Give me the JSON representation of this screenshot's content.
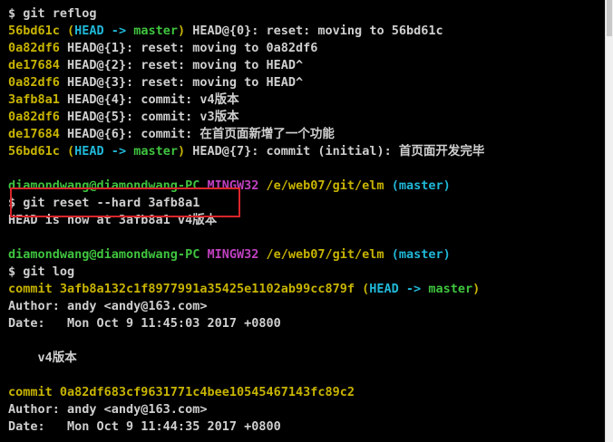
{
  "terminal": {
    "lines": [
      {
        "segments": [
          {
            "text": "$ git reflog",
            "color": "default"
          }
        ]
      },
      {
        "segments": [
          {
            "text": "56bd61c",
            "color": "yellow"
          },
          {
            "text": " (",
            "color": "yellow"
          },
          {
            "text": "HEAD -> ",
            "color": "cyan"
          },
          {
            "text": "master",
            "color": "green"
          },
          {
            "text": ")",
            "color": "yellow"
          },
          {
            "text": " HEAD@{0}: reset: moving to 56bd61c",
            "color": "default"
          }
        ]
      },
      {
        "segments": [
          {
            "text": "0a82df6",
            "color": "yellow"
          },
          {
            "text": " HEAD@{1}: reset: moving to 0a82df6",
            "color": "default"
          }
        ]
      },
      {
        "segments": [
          {
            "text": "de17684",
            "color": "yellow"
          },
          {
            "text": " HEAD@{2}: reset: moving to HEAD^",
            "color": "default"
          }
        ]
      },
      {
        "segments": [
          {
            "text": "0a82df6",
            "color": "yellow"
          },
          {
            "text": " HEAD@{3}: reset: moving to HEAD^",
            "color": "default"
          }
        ]
      },
      {
        "segments": [
          {
            "text": "3afb8a1",
            "color": "yellow"
          },
          {
            "text": " HEAD@{4}: commit: v4版本",
            "color": "default"
          }
        ]
      },
      {
        "segments": [
          {
            "text": "0a82df6",
            "color": "yellow"
          },
          {
            "text": " HEAD@{5}: commit: v3版本",
            "color": "default"
          }
        ]
      },
      {
        "segments": [
          {
            "text": "de17684",
            "color": "yellow"
          },
          {
            "text": " HEAD@{6}: commit: 在首页面新增了一个功能",
            "color": "default"
          }
        ]
      },
      {
        "segments": [
          {
            "text": "56bd61c",
            "color": "yellow"
          },
          {
            "text": " (",
            "color": "yellow"
          },
          {
            "text": "HEAD -> ",
            "color": "cyan"
          },
          {
            "text": "master",
            "color": "green"
          },
          {
            "text": ")",
            "color": "yellow"
          },
          {
            "text": " HEAD@{7}: commit (initial): 首页面开发完毕",
            "color": "default"
          }
        ]
      },
      {
        "segments": [
          {
            "text": "",
            "color": "default"
          }
        ]
      },
      {
        "segments": [
          {
            "text": "diamondwang@diamondwang-PC",
            "color": "green"
          },
          {
            "text": " ",
            "color": "default"
          },
          {
            "text": "MINGW32",
            "color": "magenta"
          },
          {
            "text": " ",
            "color": "default"
          },
          {
            "text": "/e/web07/git/elm",
            "color": "yellow"
          },
          {
            "text": " (master)",
            "color": "cyan"
          }
        ]
      },
      {
        "segments": [
          {
            "text": "$ git reset --hard 3afb8a1",
            "color": "default"
          }
        ]
      },
      {
        "segments": [
          {
            "text": "HEAD is now at 3afb8a1 v4版本",
            "color": "default"
          }
        ]
      },
      {
        "segments": [
          {
            "text": "",
            "color": "default"
          }
        ]
      },
      {
        "segments": [
          {
            "text": "diamondwang@diamondwang-PC",
            "color": "green"
          },
          {
            "text": " ",
            "color": "default"
          },
          {
            "text": "MINGW32",
            "color": "magenta"
          },
          {
            "text": " ",
            "color": "default"
          },
          {
            "text": "/e/web07/git/elm",
            "color": "yellow"
          },
          {
            "text": " (master)",
            "color": "cyan"
          }
        ]
      },
      {
        "segments": [
          {
            "text": "$ git log",
            "color": "default"
          }
        ]
      },
      {
        "segments": [
          {
            "text": "commit 3afb8a132c1f8977991a35425e1102ab99cc879f",
            "color": "yellow"
          },
          {
            "text": " (",
            "color": "yellow"
          },
          {
            "text": "HEAD -> ",
            "color": "cyan"
          },
          {
            "text": "master",
            "color": "green"
          },
          {
            "text": ")",
            "color": "yellow"
          }
        ]
      },
      {
        "segments": [
          {
            "text": "Author: andy <andy@163.com>",
            "color": "default"
          }
        ]
      },
      {
        "segments": [
          {
            "text": "Date:   Mon Oct 9 11:45:03 2017 +0800",
            "color": "default"
          }
        ]
      },
      {
        "segments": [
          {
            "text": "",
            "color": "default"
          }
        ]
      },
      {
        "segments": [
          {
            "text": "    v4版本",
            "color": "default"
          }
        ]
      },
      {
        "segments": [
          {
            "text": "",
            "color": "default"
          }
        ]
      },
      {
        "segments": [
          {
            "text": "commit 0a82df683cf9631771c4bee10545467143fc89c2",
            "color": "yellow"
          }
        ]
      },
      {
        "segments": [
          {
            "text": "Author: andy <andy@163.com>",
            "color": "default"
          }
        ]
      },
      {
        "segments": [
          {
            "text": "Date:   Mon Oct 9 11:44:35 2017 +0800",
            "color": "default"
          }
        ]
      },
      {
        "segments": [
          {
            "text": "",
            "color": "default"
          }
        ],
        "partial": true
      }
    ]
  },
  "colors": {
    "background": "#000000",
    "default": "#cfcfcf",
    "yellow": "#c8b400",
    "green": "#3fc43f",
    "cyan": "#20b8d8",
    "magenta": "#c040c0",
    "highlight_box": "#d9262b"
  }
}
